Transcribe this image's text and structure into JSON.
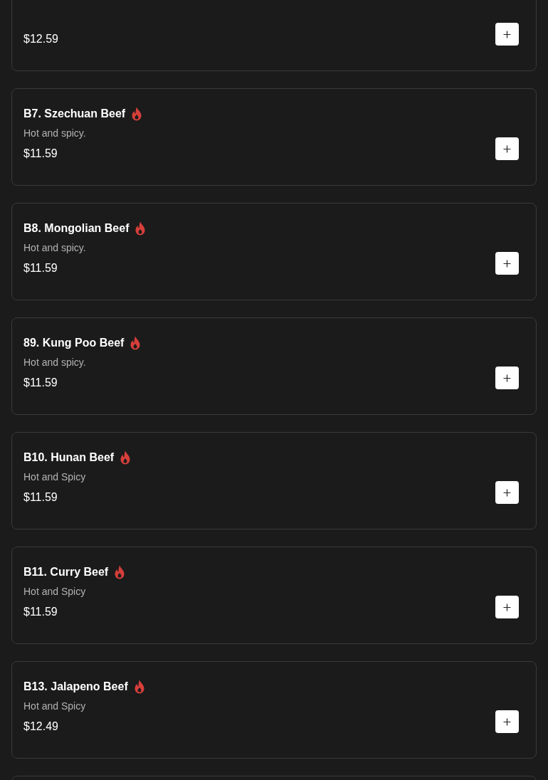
{
  "menu_items": [
    {
      "price": "$12.59"
    },
    {
      "title": "B7. Szechuan Beef",
      "spicy": true,
      "description": "Hot and spicy.",
      "price": "$11.59"
    },
    {
      "title": "B8. Mongolian Beef",
      "spicy": true,
      "description": "Hot and spicy.",
      "price": "$11.59"
    },
    {
      "title": "89. Kung Poo Beef",
      "spicy": true,
      "description": "Hot and spicy.",
      "price": "$11.59"
    },
    {
      "title": "B10. Hunan Beef",
      "spicy": true,
      "description": "Hot and Spicy",
      "price": "$11.59"
    },
    {
      "title": "B11. Curry Beef",
      "spicy": true,
      "description": "Hot and Spicy",
      "price": "$11.59"
    },
    {
      "title": "B13. Jalapeno Beef",
      "spicy": true,
      "description": "Hot and Spicy",
      "price": "$12.49"
    }
  ]
}
